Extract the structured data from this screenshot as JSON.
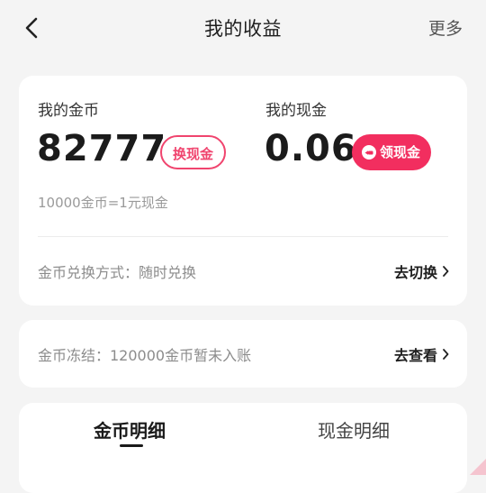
{
  "header": {
    "title": "我的收益",
    "more_label": "更多"
  },
  "coins": {
    "label": "我的金币",
    "amount": "82777",
    "exchange_button": "换现金",
    "rate_text": "10000金币=1元现金"
  },
  "cash": {
    "label": "我的现金",
    "amount": "0.06",
    "withdraw_button": "领现金"
  },
  "exchange_mode": {
    "text": "金币兑换方式：随时兑换",
    "link_label": "去切换"
  },
  "frozen": {
    "text": "金币冻结：120000金币暂未入账",
    "link_label": "去查看"
  },
  "tabs": [
    {
      "label": "金币明细",
      "active": true
    },
    {
      "label": "现金明细",
      "active": false
    }
  ],
  "colors": {
    "accent": "#f22e5f",
    "background": "#f4f4f4",
    "card": "#ffffff"
  }
}
